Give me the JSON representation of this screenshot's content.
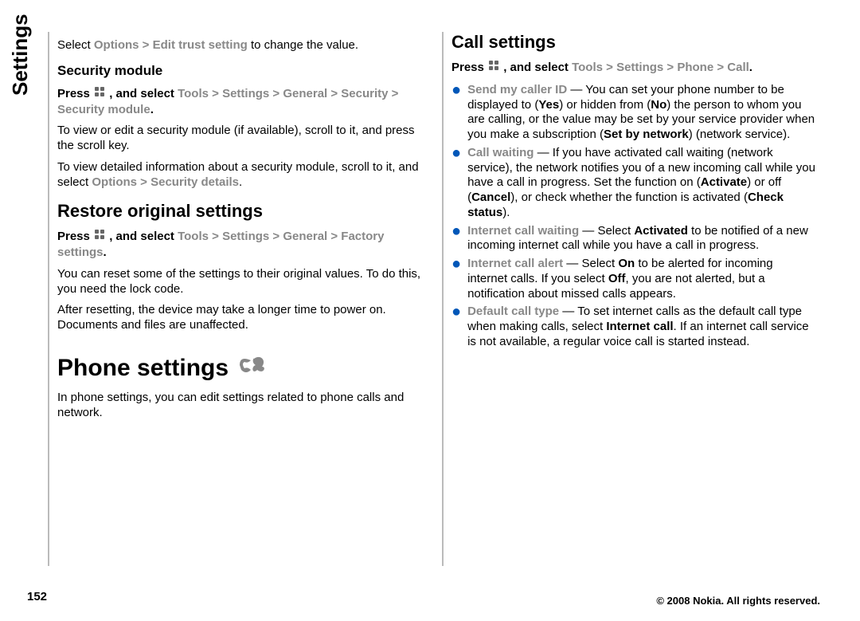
{
  "side_label": "Settings",
  "page_number": "152",
  "footer": "© 2008 Nokia. All rights reserved.",
  "left": {
    "p1_pre": "Select ",
    "p1_nav": "Options > Edit trust setting",
    "p1_post": " to change the value.",
    "sec_module_h": "Security module",
    "p2_pre": "Press ",
    "p2_mid": " , and select ",
    "p2_nav": "Tools > Settings > General > Security > Security module",
    "p2_end": ".",
    "p3": "To view or edit a security module (if available), scroll to it, and press the scroll key.",
    "p4_pre": "To view detailed information about a security module, scroll to it, and select ",
    "p4_nav": "Options > Security details",
    "p4_end": ".",
    "restore_h": "Restore original settings",
    "p5_pre": "Press ",
    "p5_mid": " , and select ",
    "p5_nav": "Tools > Settings > General > Factory settings",
    "p5_end": ".",
    "p6": "You can reset some of the settings to their original values. To do this, you need the lock code.",
    "p7": "After resetting, the device may take a longer time to power on. Documents and files are unaffected.",
    "phone_h": "Phone settings",
    "p8": "In phone settings, you can edit settings related to phone calls and network."
  },
  "right": {
    "call_h": "Call settings",
    "p1_pre": "Press ",
    "p1_mid": " , and select ",
    "p1_nav": "Tools > Settings > Phone > Call",
    "p1_end": ".",
    "b1_label": "Send my caller ID",
    "b1_a": " — You can set your phone number to be displayed to (",
    "b1_yes": "Yes",
    "b1_b": ") or hidden from (",
    "b1_no": "No",
    "b1_c": ") the person to whom you are calling, or the value may be set by your service provider when you make a subscription (",
    "b1_net": "Set by network",
    "b1_d": ") (network service).",
    "b2_label": "Call waiting",
    "b2_a": " — If you have activated call waiting (network service), the network notifies you of a new incoming call while you have a call in progress. Set the function on (",
    "b2_act": "Activate",
    "b2_b": ") or off (",
    "b2_can": "Cancel",
    "b2_c": "), or check whether the function is activated (",
    "b2_chk": "Check status",
    "b2_d": ").",
    "b3_label": "Internet call waiting",
    "b3_a": " — Select ",
    "b3_act": "Activated",
    "b3_b": " to be notified of a new incoming internet call while you have a call in progress.",
    "b4_label": "Internet call alert",
    "b4_a": " — Select ",
    "b4_on": "On",
    "b4_b": " to be alerted for incoming internet calls. If you select ",
    "b4_off": "Off",
    "b4_c": ", you are not alerted, but a notification about missed calls appears.",
    "b5_label": "Default call type",
    "b5_a": " — To set internet calls as the default call type when making calls, select ",
    "b5_ic": "Internet call",
    "b5_b": ". If an internet call service is not available, a regular voice call is started instead."
  }
}
